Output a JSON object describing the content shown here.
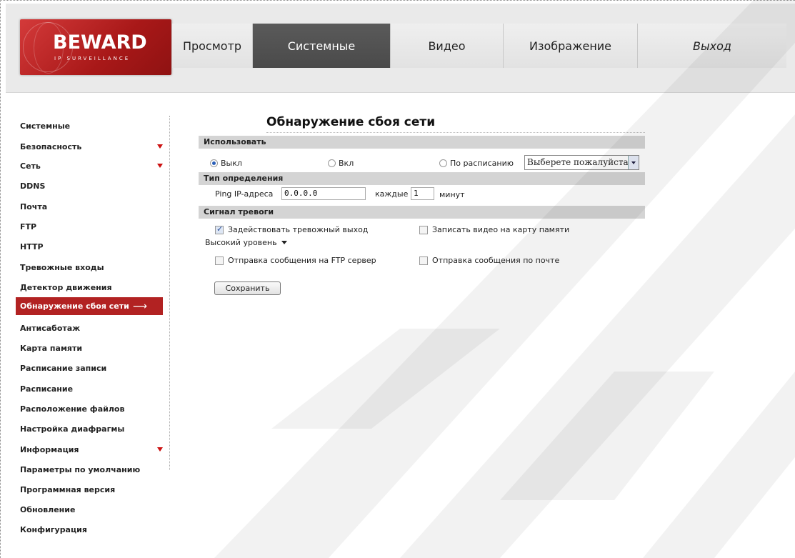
{
  "logo": {
    "brand": "BEWARD",
    "tagline": "IP SURVEILLANCE"
  },
  "nav": [
    {
      "label": "Просмотр",
      "active": false
    },
    {
      "label": "Системные",
      "active": true
    },
    {
      "label": "Видео",
      "active": false
    },
    {
      "label": "Изображение",
      "active": false
    },
    {
      "label": "Выход",
      "active": false
    }
  ],
  "sidebar": [
    {
      "label": "Системные",
      "expandable": false,
      "active": false
    },
    {
      "label": "Безопасность",
      "expandable": true,
      "active": false
    },
    {
      "label": "Сеть",
      "expandable": true,
      "active": false
    },
    {
      "label": "DDNS",
      "expandable": false,
      "active": false
    },
    {
      "label": "Почта",
      "expandable": false,
      "active": false
    },
    {
      "label": "FTP",
      "expandable": false,
      "active": false
    },
    {
      "label": "HTTP",
      "expandable": false,
      "active": false
    },
    {
      "label": "Тревожные входы",
      "expandable": false,
      "active": false
    },
    {
      "label": "Детектор движения",
      "expandable": false,
      "active": false
    },
    {
      "label": "Обнаружение сбоя сети",
      "expandable": false,
      "active": true
    },
    {
      "label": "Антисаботаж",
      "expandable": false,
      "active": false
    },
    {
      "label": "Карта памяти",
      "expandable": false,
      "active": false
    },
    {
      "label": "Расписание записи",
      "expandable": false,
      "active": false
    },
    {
      "label": "Расписание",
      "expandable": false,
      "active": false
    },
    {
      "label": "Расположение файлов",
      "expandable": false,
      "active": false
    },
    {
      "label": "Настройка диафрагмы",
      "expandable": false,
      "active": false
    },
    {
      "label": "Информация",
      "expandable": true,
      "active": false
    },
    {
      "label": "Параметры по умолчанию",
      "expandable": false,
      "active": false
    },
    {
      "label": "Программная версия",
      "expandable": false,
      "active": false
    },
    {
      "label": "Обновление",
      "expandable": false,
      "active": false
    },
    {
      "label": "Конфигурация",
      "expandable": false,
      "active": false
    }
  ],
  "main": {
    "title": "Обнаружение сбоя сети",
    "use": {
      "header": "Использовать",
      "off_label": "Выкл",
      "on_label": "Вкл",
      "schedule_label": "По расписанию",
      "selected": "off",
      "schedule_select": "Выберете пожалуйста..."
    },
    "detection": {
      "header": "Тип определения",
      "ping_label": "Ping IP-адреса",
      "ip_value": "0.0.0.0",
      "every_label": "каждые",
      "interval_value": "1",
      "unit_label": "минут"
    },
    "alarm": {
      "header": "Сигнал тревоги",
      "alarm_output_label": "Задействовать тревожный выход",
      "alarm_output_checked": true,
      "record_label": "Записать видео на карту памяти",
      "record_checked": false,
      "level_value": "Высокий уровень",
      "ftp_label": "Отправка сообщения на FTP сервер",
      "ftp_checked": false,
      "mail_label": "Отправка сообщения по почте",
      "mail_checked": false
    },
    "save_label": "Сохранить"
  },
  "colors": {
    "accent": "#b22222",
    "nav_active": "#505050",
    "section_bar": "#d4d4d4"
  },
  "watermark": "BEWARD"
}
